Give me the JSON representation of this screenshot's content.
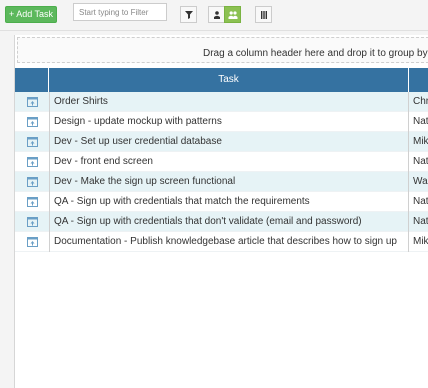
{
  "toolbar": {
    "add_task_label": "+ Add Task",
    "filter_placeholder": "Start typing to Filter"
  },
  "icons": {
    "filter": "funnel-icon",
    "person": "person-icon",
    "people": "people-icon",
    "columns": "columns-icon",
    "row": "task-row-icon"
  },
  "colors": {
    "header": "#3572a1",
    "add_task": "#5cb85c",
    "active_toggle": "#8cc152",
    "alt_row": "#e6f3f6"
  },
  "grid": {
    "group_hint": "Drag a column header here and drop it to group by t",
    "columns": [
      "",
      "Task",
      ""
    ],
    "rows": [
      {
        "task": "Order Shirts",
        "assignee": "Chr"
      },
      {
        "task": "Design - update mockup with patterns",
        "assignee": "Nat"
      },
      {
        "task": "Dev - Set up user credential database",
        "assignee": "Mik"
      },
      {
        "task": "Dev - front end screen",
        "assignee": "Nat"
      },
      {
        "task": "Dev - Make the sign up screen functional",
        "assignee": "Wal"
      },
      {
        "task": "QA - Sign up with credentials that match the requirements",
        "assignee": "Nat"
      },
      {
        "task": "QA - Sign up with credentials that don't validate (email and password)",
        "assignee": "Nat"
      },
      {
        "task": "Documentation - Publish knowledgebase article that describes how to sign up",
        "assignee": "Mik"
      }
    ]
  }
}
